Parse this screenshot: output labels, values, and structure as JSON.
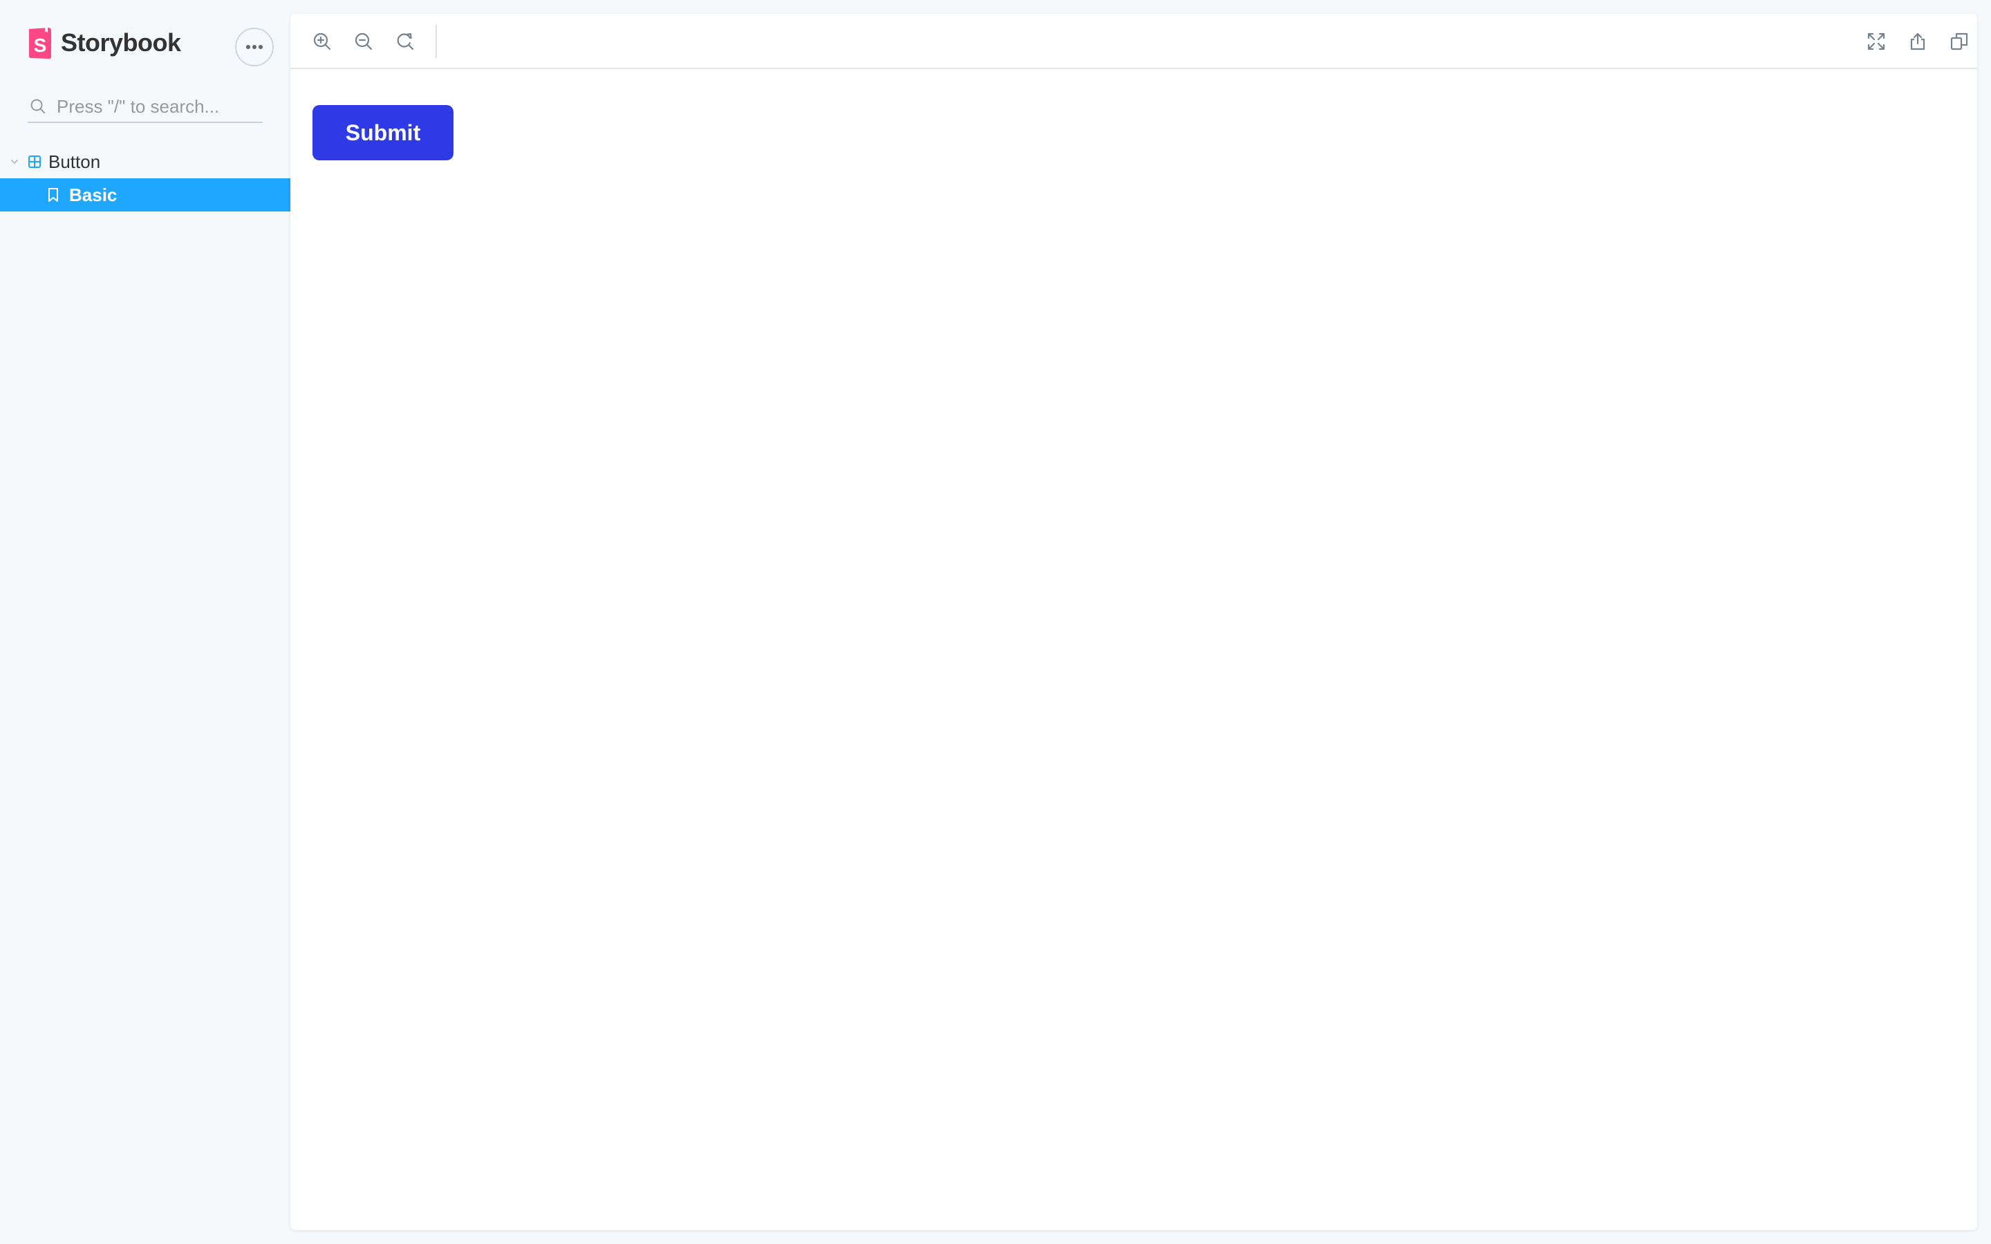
{
  "app": {
    "name": "Storybook"
  },
  "sidebar": {
    "menu_button_icon": "ellipsis-icon",
    "search": {
      "placeholder": "Press \"/\" to search...",
      "value": ""
    },
    "tree": {
      "component": {
        "label": "Button",
        "icon": "component-icon",
        "expanded": true
      },
      "stories": [
        {
          "label": "Basic",
          "icon": "bookmark-icon",
          "selected": true
        }
      ]
    }
  },
  "toolbar": {
    "left_tools": [
      "zoom-in-icon",
      "zoom-out-icon",
      "zoom-reset-icon"
    ],
    "right_tools": [
      "fullscreen-icon",
      "share-icon",
      "copy-icon"
    ]
  },
  "preview": {
    "button_label": "Submit"
  },
  "colors": {
    "brand": "#ff4785",
    "selection": "#1ea7fd",
    "submit_button": "#2d3ae6",
    "icon_gray": "#73828c"
  }
}
